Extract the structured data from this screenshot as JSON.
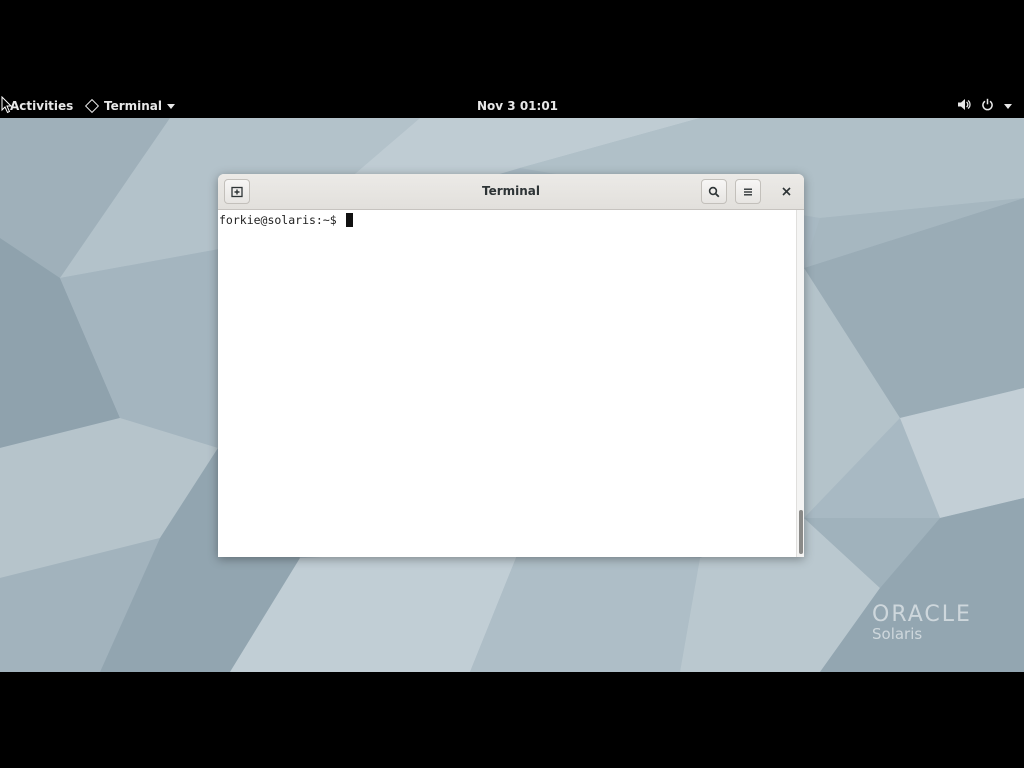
{
  "topbar": {
    "activities_label": "Activities",
    "app_menu_label": "Terminal",
    "clock": "Nov 3  01:01",
    "icons": [
      "volume-icon",
      "power-icon",
      "chevron-down-icon"
    ]
  },
  "window": {
    "title": "Terminal",
    "new_tab_icon": "new-tab-icon",
    "search_icon": "search-icon",
    "menu_icon": "hamburger-menu-icon",
    "close_icon": "close-icon"
  },
  "terminal": {
    "prompt": "forkie@solaris:~$ "
  },
  "wallpaper": {
    "logo_text": "ORACLE",
    "logo_subtext": "Solaris"
  },
  "colors": {
    "panel": "#000000",
    "wallpaper_base": "#a9bac4",
    "headerbar": "#e6e4e1",
    "terminal_bg": "#ffffff"
  }
}
